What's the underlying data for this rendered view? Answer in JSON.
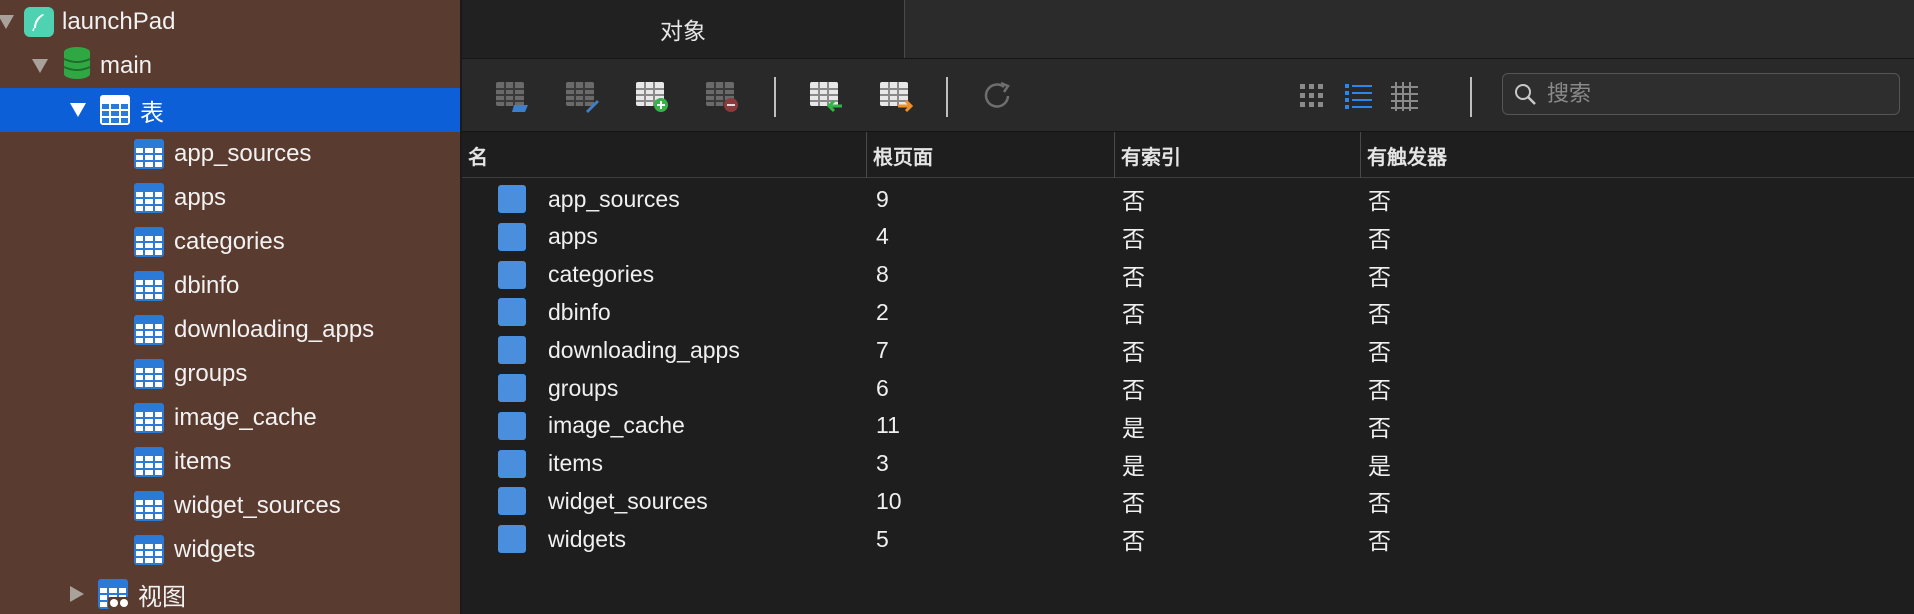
{
  "sidebar": {
    "database": "launchPad",
    "schema": "main",
    "tables_group": "表",
    "tables": [
      "app_sources",
      "apps",
      "categories",
      "dbinfo",
      "downloading_apps",
      "groups",
      "image_cache",
      "items",
      "widget_sources",
      "widgets"
    ],
    "views_group": "视图"
  },
  "tabs": {
    "objects": "对象"
  },
  "search": {
    "placeholder": "搜索"
  },
  "table": {
    "headers": {
      "name": "名",
      "root_page": "根页面",
      "has_index": "有索引",
      "has_trigger": "有触发器"
    },
    "rows": [
      {
        "name": "app_sources",
        "root_page": "9",
        "has_index": "否",
        "has_trigger": "否"
      },
      {
        "name": "apps",
        "root_page": "4",
        "has_index": "否",
        "has_trigger": "否"
      },
      {
        "name": "categories",
        "root_page": "8",
        "has_index": "否",
        "has_trigger": "否"
      },
      {
        "name": "dbinfo",
        "root_page": "2",
        "has_index": "否",
        "has_trigger": "否"
      },
      {
        "name": "downloading_apps",
        "root_page": "7",
        "has_index": "否",
        "has_trigger": "否"
      },
      {
        "name": "groups",
        "root_page": "6",
        "has_index": "否",
        "has_trigger": "否"
      },
      {
        "name": "image_cache",
        "root_page": "11",
        "has_index": "是",
        "has_trigger": "否"
      },
      {
        "name": "items",
        "root_page": "3",
        "has_index": "是",
        "has_trigger": "是"
      },
      {
        "name": "widget_sources",
        "root_page": "10",
        "has_index": "否",
        "has_trigger": "否"
      },
      {
        "name": "widgets",
        "root_page": "5",
        "has_index": "否",
        "has_trigger": "否"
      }
    ]
  },
  "colors": {
    "sidebar_bg": "#5a3b30",
    "selection": "#0d5fd8",
    "accent_blue": "#2b7ad8"
  }
}
